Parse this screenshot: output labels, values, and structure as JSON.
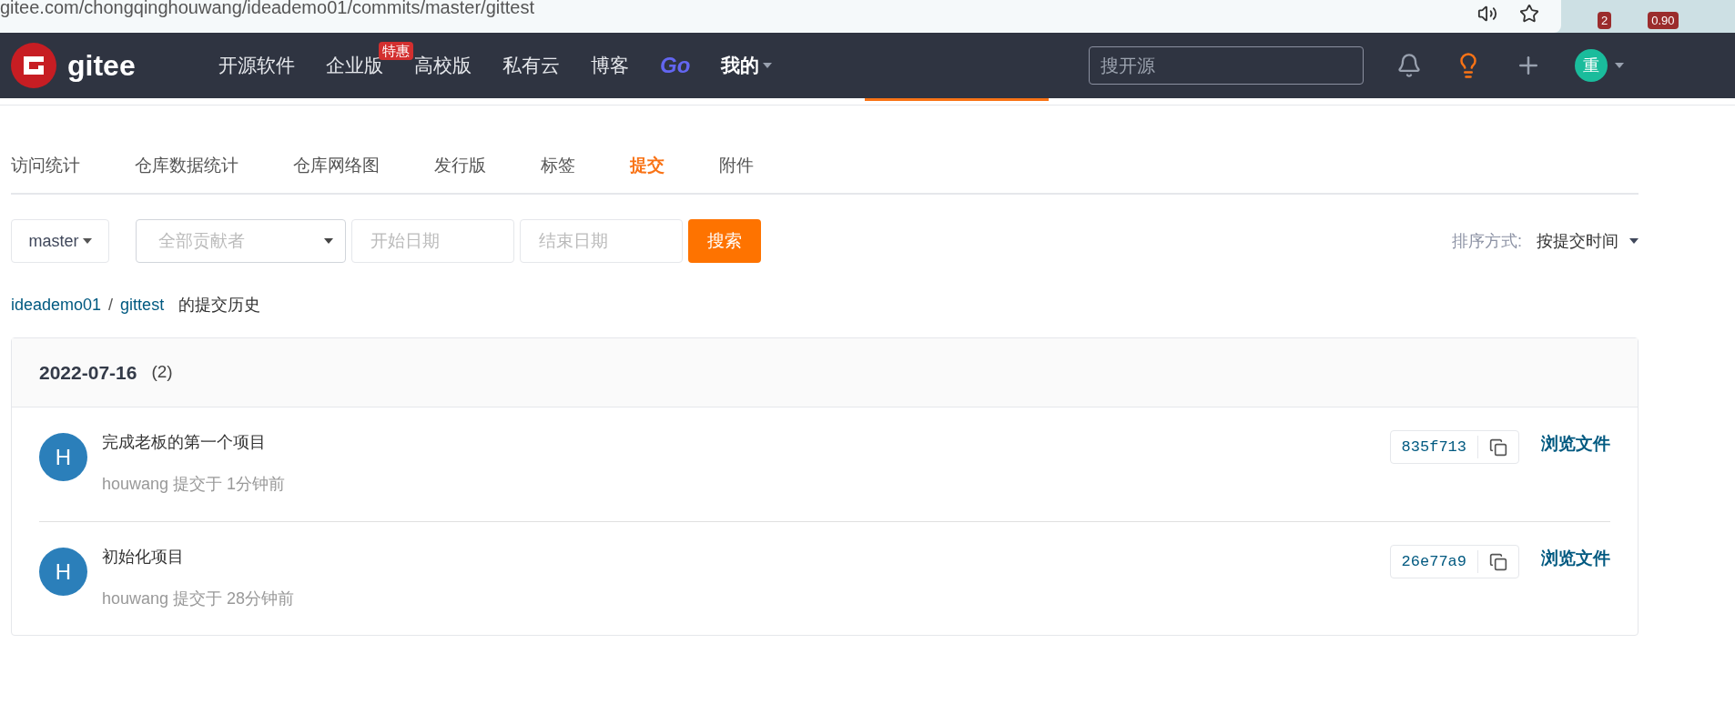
{
  "browser": {
    "address": "gitee.com/chongqinghouwang/ideademo01/commits/master/gittest",
    "extension_badges": [
      "2",
      "0.90"
    ]
  },
  "navbar": {
    "logo": "gitee",
    "items": [
      {
        "label": "开源软件",
        "kind": "text"
      },
      {
        "label": "企业版",
        "kind": "text",
        "badge": "特惠"
      },
      {
        "label": "高校版",
        "kind": "text"
      },
      {
        "label": "私有云",
        "kind": "text"
      },
      {
        "label": "博客",
        "kind": "text"
      },
      {
        "label": "Go",
        "kind": "brand"
      },
      {
        "label": "我的",
        "kind": "menu"
      }
    ],
    "search": {
      "placeholder": "搜开源"
    },
    "avatar": "重"
  },
  "tabs": [
    {
      "label": "访问统计",
      "selected": false
    },
    {
      "label": "仓库数据统计",
      "selected": false
    },
    {
      "label": "仓库网络图",
      "selected": false
    },
    {
      "label": "发行版",
      "selected": false
    },
    {
      "label": "标签",
      "selected": false
    },
    {
      "label": "提交",
      "selected": true
    },
    {
      "label": "附件",
      "selected": false
    }
  ],
  "filters": {
    "branch": "master",
    "contributor": {
      "placeholder": "全部贡献者"
    },
    "start_date": {
      "placeholder": "开始日期"
    },
    "end_date": {
      "placeholder": "结束日期"
    },
    "search_button": "搜索",
    "sort_label": "排序方式:",
    "sort_value": "按提交时间"
  },
  "breadcrumb": {
    "repo": "ideademo01",
    "separator": "/",
    "branch": "gittest",
    "suffix": "的提交历史"
  },
  "commit_groups": [
    {
      "date": "2022-07-16",
      "count": "(2)",
      "commits": [
        {
          "avatar": "H",
          "title": "完成老板的第一个项目",
          "meta": "houwang 提交于 1分钟前",
          "hash": "835f713",
          "browse": "浏览文件"
        },
        {
          "avatar": "H",
          "title": "初始化项目",
          "meta": "houwang 提交于 28分钟前",
          "hash": "26e77a9",
          "browse": "浏览文件"
        }
      ]
    }
  ]
}
